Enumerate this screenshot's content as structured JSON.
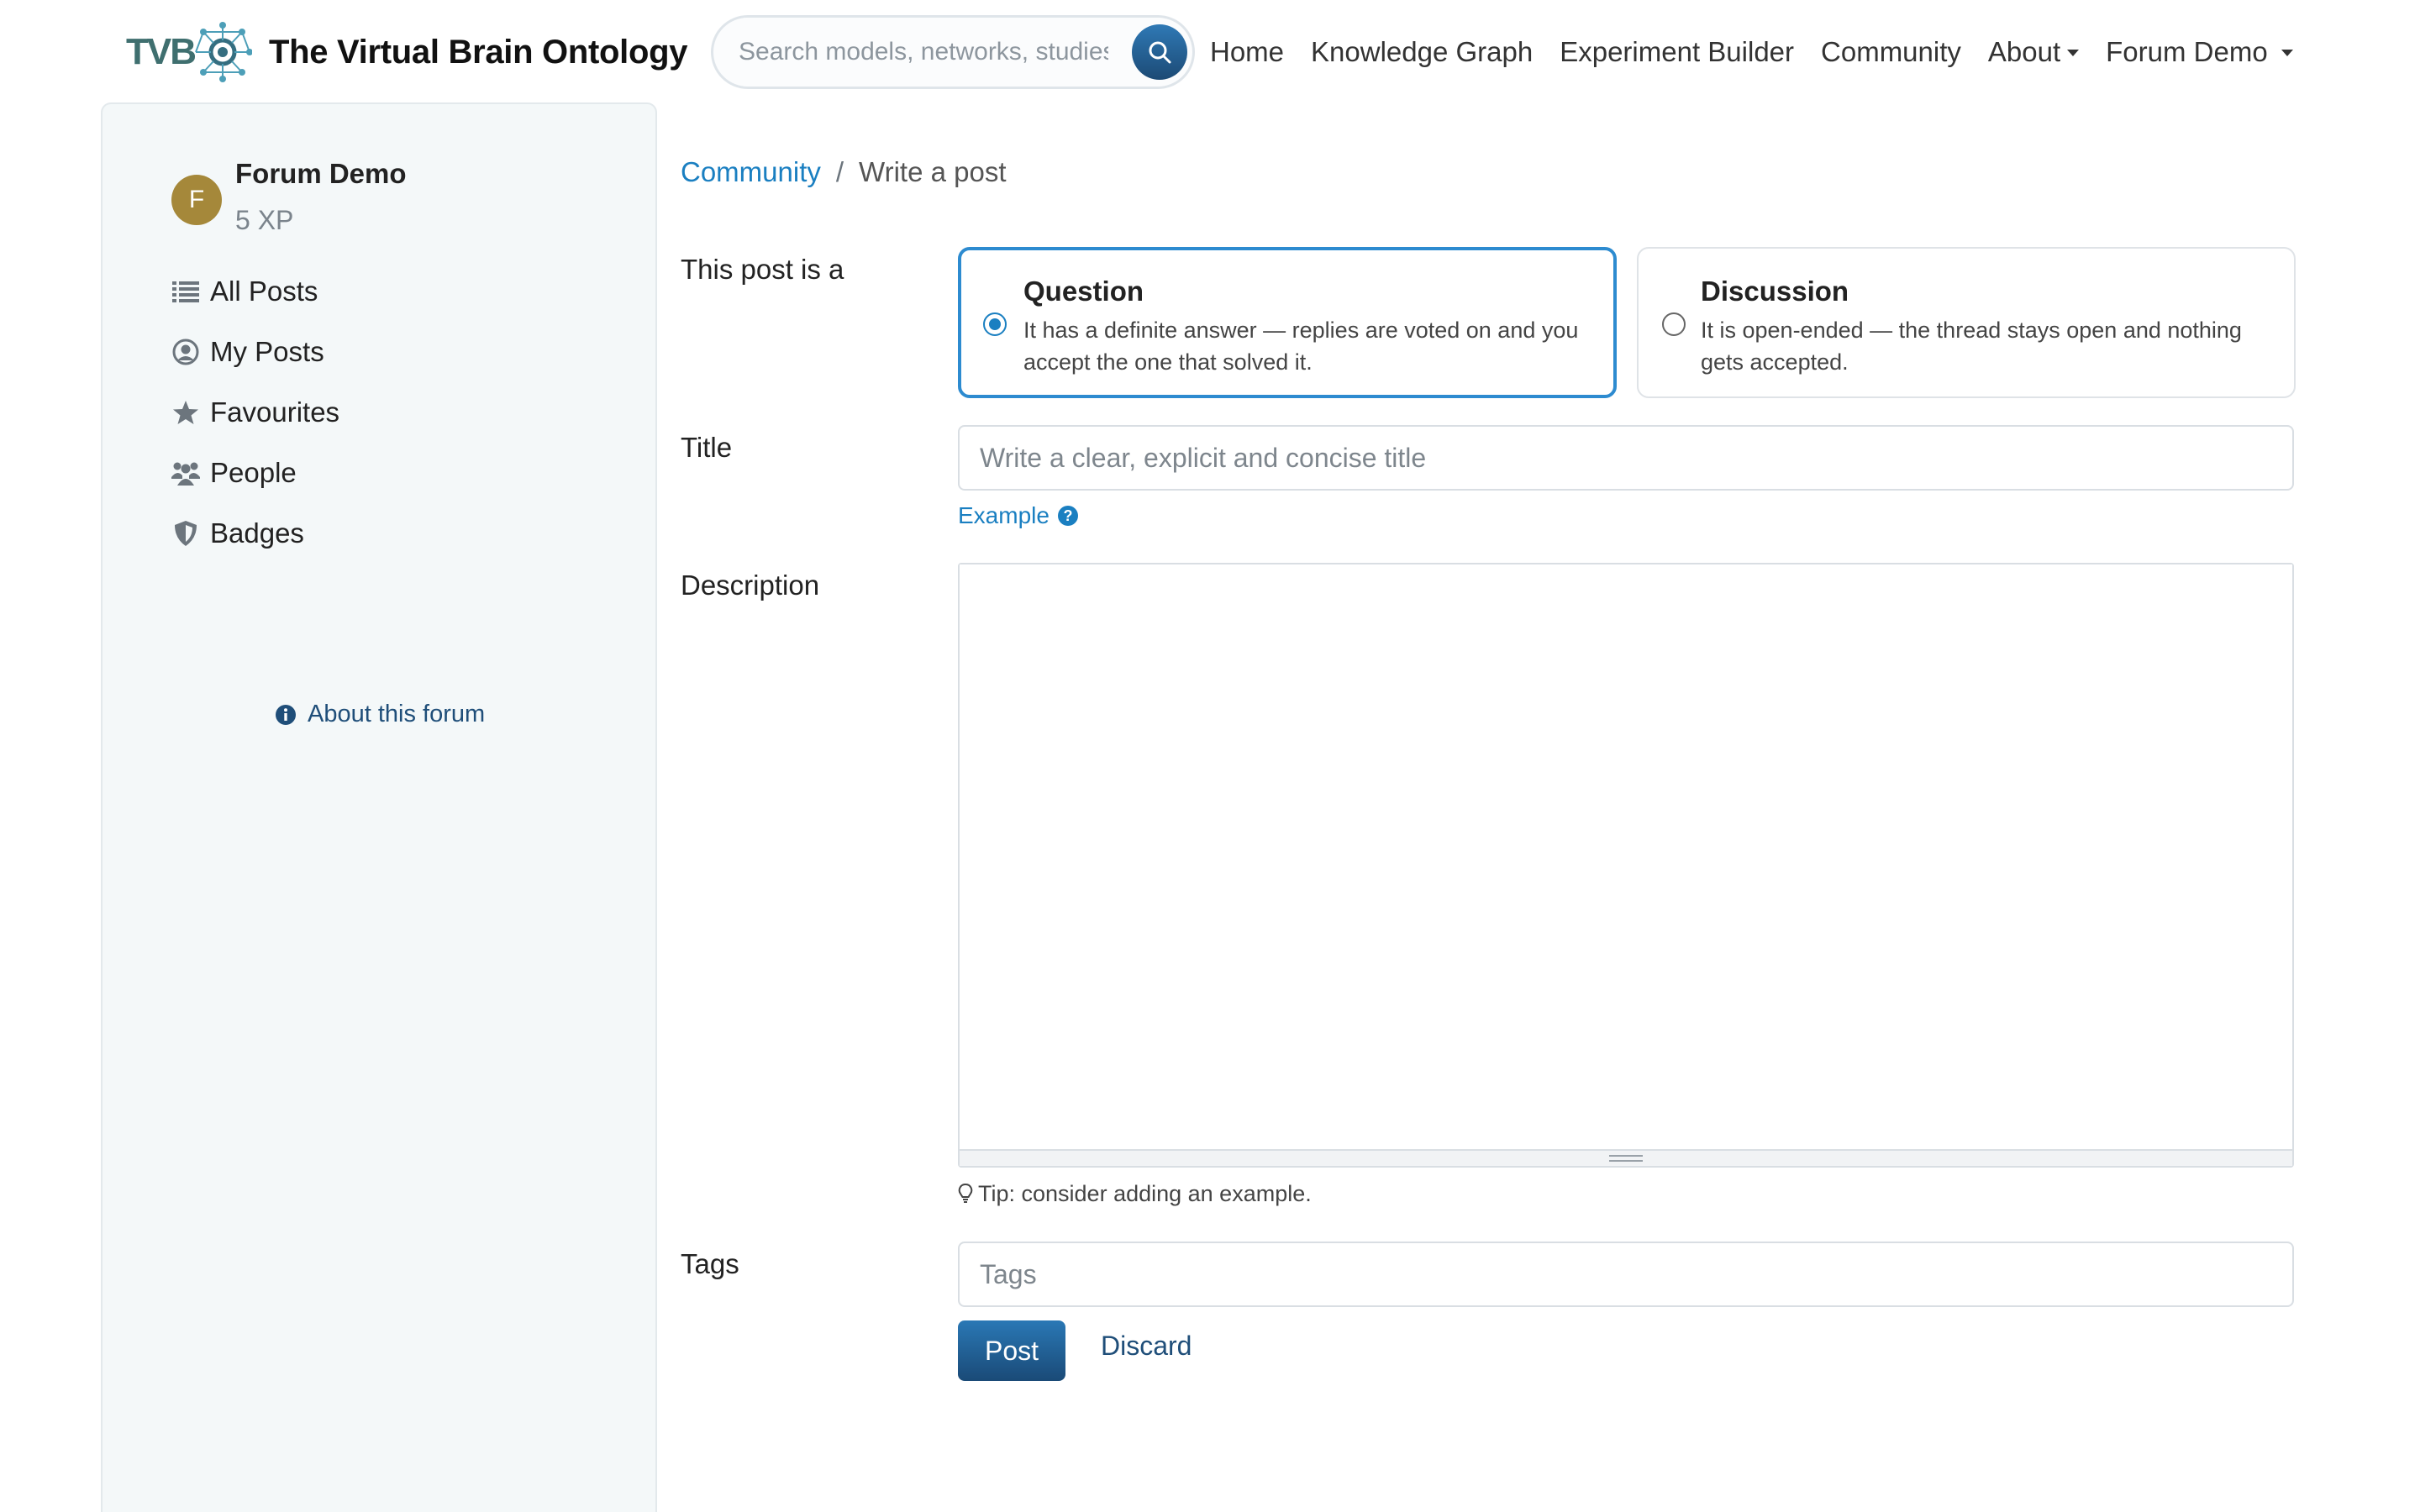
{
  "navbar": {
    "logo_text": "TVB",
    "brand_title": "The Virtual Brain Ontology",
    "search_placeholder": "Search models, networks, studies...",
    "links": {
      "home": "Home",
      "knowledge_graph": "Knowledge Graph",
      "experiment_builder": "Experiment Builder",
      "community": "Community",
      "about": "About",
      "user_menu": "Forum Demo"
    }
  },
  "sidebar": {
    "user": {
      "avatar_initial": "F",
      "name": "Forum Demo",
      "xp": "5 XP"
    },
    "items": {
      "all_posts": "All Posts",
      "my_posts": "My Posts",
      "favourites": "Favourites",
      "people": "People",
      "badges": "Badges"
    },
    "about_forum": "About this forum"
  },
  "breadcrumb": {
    "parent": "Community",
    "separator": "/",
    "current": "Write a post"
  },
  "form": {
    "type_label": "This post is a",
    "question": {
      "title": "Question",
      "description": "It has a definite answer — replies are voted on and you accept the one that solved it.",
      "selected": true
    },
    "discussion": {
      "title": "Discussion",
      "description": "It is open-ended — the thread stays open and nothing gets accepted.",
      "selected": false
    },
    "title_label": "Title",
    "title_placeholder": "Write a clear, explicit and concise title",
    "example_link": "Example",
    "description_label": "Description",
    "tip": "Tip: consider adding an example.",
    "tags_label": "Tags",
    "tags_placeholder": "Tags",
    "post_button": "Post",
    "discard_button": "Discard"
  },
  "colors": {
    "accent": "#1a7fc1",
    "primary_button": "#1f5f94",
    "sidebar_bg": "#f4f8f9",
    "avatar_bg": "#a5883a"
  }
}
